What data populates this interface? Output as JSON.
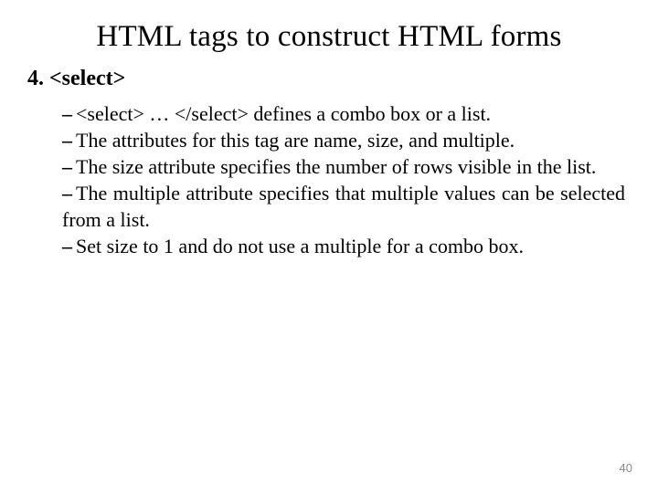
{
  "title": "HTML tags to construct HTML forms",
  "section_number": "4.",
  "section_heading": "<select>",
  "bullets": [
    "<select> … </select> defines a combo box or a list.",
    "The attributes for this tag are name, size, and multiple.",
    "The size attribute specifies the number of rows visible in the list.",
    "The multiple attribute specifies that multiple values can be selected from a list.",
    "Set size to 1 and do not use a multiple for a combo box."
  ],
  "page_number": "40"
}
